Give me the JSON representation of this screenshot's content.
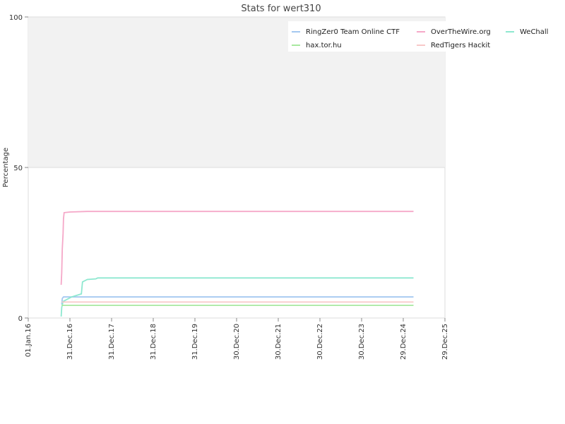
{
  "chart_data": {
    "type": "line",
    "title": "Stats for wert310",
    "xlabel": "",
    "ylabel": "Percentage",
    "ylim": [
      0,
      100
    ],
    "yticks": [
      0,
      50,
      100
    ],
    "grid": true,
    "legend_position": "top-right",
    "x_ticks": [
      "01.Jan.16",
      "31.Dec.16",
      "31.Dec.17",
      "31.Dec.18",
      "31.Dec.19",
      "30.Dec.20",
      "30.Dec.21",
      "30.Dec.22",
      "30.Dec.23",
      "29.Dec.24",
      "29.Dec.25"
    ],
    "series": [
      {
        "name": "RingZer0 Team Online CTF",
        "color": "#a4c8f0",
        "points": [
          [
            "2016-10-20",
            4.5
          ],
          [
            "2016-10-25",
            6.5
          ],
          [
            "2016-11-05",
            7.0
          ],
          [
            "2025-03-29",
            7.0
          ]
        ]
      },
      {
        "name": "OverTheWire.org",
        "color": "#f5a8c8",
        "points": [
          [
            "2016-10-15",
            11
          ],
          [
            "2016-10-20",
            15
          ],
          [
            "2016-10-25",
            23
          ],
          [
            "2016-11-01",
            28
          ],
          [
            "2016-11-05",
            33
          ],
          [
            "2016-11-10",
            35
          ],
          [
            "2017-01-01",
            35.2
          ],
          [
            "2017-06-01",
            35.4
          ],
          [
            "2025-03-29",
            35.4
          ]
        ]
      },
      {
        "name": "WeChall",
        "color": "#8ee8d0",
        "points": [
          [
            "2016-10-15",
            0.5
          ],
          [
            "2016-10-20",
            3.5
          ],
          [
            "2016-11-01",
            5.5
          ],
          [
            "2017-01-15",
            7.0
          ],
          [
            "2017-04-10",
            8.0
          ],
          [
            "2017-04-20",
            12.0
          ],
          [
            "2017-06-01",
            12.8
          ],
          [
            "2017-08-15",
            13.0
          ],
          [
            "2017-09-01",
            13.3
          ],
          [
            "2025-03-29",
            13.3
          ]
        ]
      },
      {
        "name": "hax.tor.hu",
        "color": "#a8e8a0",
        "points": [
          [
            "2016-10-20",
            4.2
          ],
          [
            "2025-03-29",
            4.2
          ]
        ]
      },
      {
        "name": "RedTigers Hackit",
        "color": "#f8c8c8",
        "points": [
          [
            "2016-10-20",
            5.3
          ],
          [
            "2025-03-29",
            5.3
          ]
        ]
      }
    ]
  }
}
